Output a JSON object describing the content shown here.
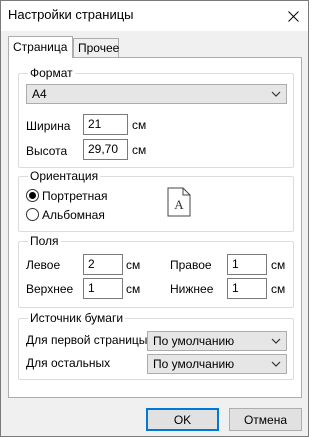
{
  "window": {
    "title": "Настройки страницы"
  },
  "tabs": [
    {
      "label": "Страница",
      "active": true
    },
    {
      "label": "Прочее",
      "active": false
    }
  ],
  "format": {
    "group_title": "Формат",
    "paper_size": "A4",
    "width_label": "Ширина",
    "width_value": "21",
    "width_unit": "см",
    "height_label": "Высота",
    "height_value": "29,70",
    "height_unit": "см"
  },
  "orientation": {
    "group_title": "Ориентация",
    "portrait_label": "Портретная",
    "landscape_label": "Альбомная",
    "selected": "portrait",
    "preview_glyph": "A"
  },
  "margins": {
    "group_title": "Поля",
    "left_label": "Левое",
    "left_value": "2",
    "right_label": "Правое",
    "right_value": "1",
    "top_label": "Верхнее",
    "top_value": "1",
    "bottom_label": "Нижнее",
    "bottom_value": "1",
    "unit": "см"
  },
  "paper_source": {
    "group_title": "Источник бумаги",
    "first_page_label": "Для первой страницы",
    "first_page_value": "По умолчанию",
    "others_label": "Для остальных",
    "others_value": "По умолчанию"
  },
  "buttons": {
    "ok": "OK",
    "cancel": "Отмена"
  },
  "colors": {
    "accent": "#0078d7"
  }
}
